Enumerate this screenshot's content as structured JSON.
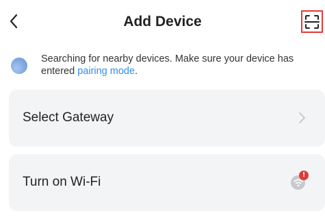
{
  "header": {
    "title": "Add Device",
    "back_icon": "chevron-left-icon",
    "scan_icon": "scan-icon"
  },
  "search": {
    "text": "Searching for nearby devices. Make sure your device has entered ",
    "link": "pairing mode",
    "suffix": "."
  },
  "cards": {
    "gateway": {
      "label": "Select Gateway"
    },
    "wifi": {
      "label": "Turn on Wi-Fi",
      "badge": "!"
    }
  },
  "colors": {
    "accent": "#2f8cf0",
    "alert": "#e53935",
    "card_bg": "#f3f4f6"
  }
}
